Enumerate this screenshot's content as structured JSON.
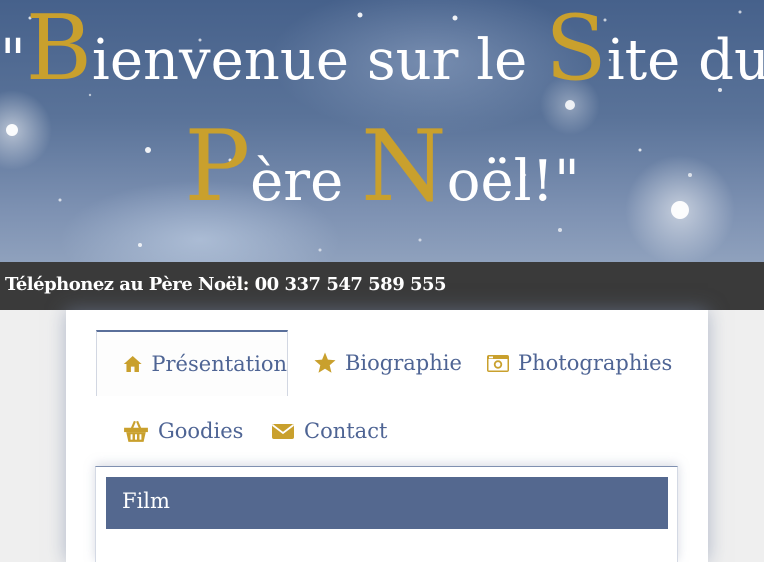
{
  "banner": {
    "open_quote": "\"",
    "line1_cap1": "B",
    "line1_rest1": "ienvenue sur le ",
    "line1_cap2": "S",
    "line1_rest2": "ite du",
    "line2_cap1": "P",
    "line2_rest1": "ère ",
    "line2_cap2": "N",
    "line2_rest2": "oël!\""
  },
  "phone_bar": {
    "text": "Téléphonez au Père Noël: 00 337 547 589 555"
  },
  "tabs": [
    {
      "label": "Présentation",
      "icon": "home-icon",
      "active": true
    },
    {
      "label": "Biographie",
      "icon": "star-icon",
      "active": false
    },
    {
      "label": "Photographies",
      "icon": "camera-icon",
      "active": false
    },
    {
      "label": "Goodies",
      "icon": "basket-icon",
      "active": false
    },
    {
      "label": "Contact",
      "icon": "envelope-icon",
      "active": false
    }
  ],
  "panel": {
    "heading": "Film"
  },
  "colors": {
    "gold": "#c9a02d",
    "navy": "#54688f",
    "tab_text": "#4e6494",
    "phone_bar": "#3a3a3a"
  }
}
